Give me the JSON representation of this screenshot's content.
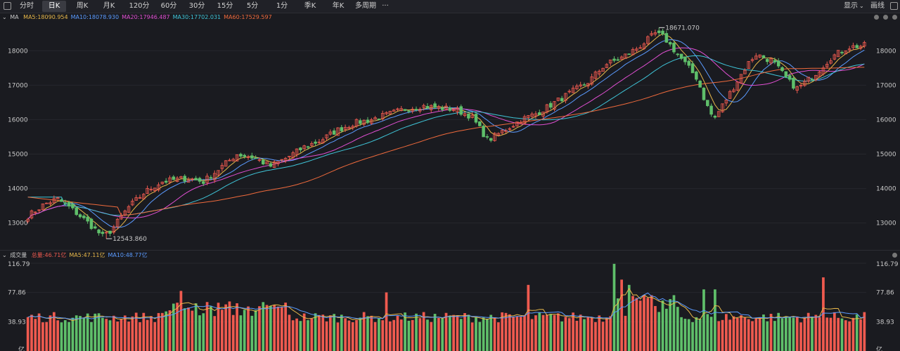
{
  "toolbar": {
    "tabs": [
      "分时",
      "日K",
      "周K",
      "月K",
      "120分",
      "60分",
      "30分",
      "15分",
      "5分",
      "1分",
      "季K",
      "年K",
      "多周期",
      "···"
    ],
    "active_tab": "日K",
    "display_label": "显示",
    "draw_label": "画线"
  },
  "ma_legend": {
    "title": "MA",
    "items": [
      {
        "label": "MA5:18090.954",
        "color": "#e8b84a"
      },
      {
        "label": "MA10:18078.930",
        "color": "#5b9bff"
      },
      {
        "label": "MA20:17946.487",
        "color": "#e14fd3"
      },
      {
        "label": "MA30:17702.031",
        "color": "#3fc5d8"
      },
      {
        "label": "MA60:17529.597",
        "color": "#ef6a3c"
      }
    ]
  },
  "vol_legend": {
    "title": "成交量",
    "items": [
      {
        "label": "总量:46.71亿",
        "color": "#ef5a4f"
      },
      {
        "label": "MA5:47.11亿",
        "color": "#e8b84a"
      },
      {
        "label": "MA10:48.77亿",
        "color": "#5b9bff"
      }
    ]
  },
  "colors": {
    "up": "#ef5a4f",
    "down": "#5fbf6a",
    "bg": "#1a1b20",
    "grid": "#26272d"
  },
  "chart_data": [
    {
      "type": "candlestick",
      "y_ticks": [
        "18000",
        "17000",
        "16000",
        "15000",
        "14000",
        "13000"
      ],
      "y_tick_values": [
        18000,
        17000,
        16000,
        15000,
        14000,
        13000
      ],
      "ylim": [
        12300,
        18800
      ],
      "annotations": [
        {
          "text": "18671.070",
          "value": 18671.07,
          "position_fraction": 0.755
        },
        {
          "text": "12543.860",
          "value": 12543.86,
          "position_fraction": 0.093
        }
      ],
      "anchors": [
        [
          0,
          13200
        ],
        [
          0.02,
          13550
        ],
        [
          0.035,
          13700
        ],
        [
          0.05,
          13450
        ],
        [
          0.07,
          13050
        ],
        [
          0.09,
          12600
        ],
        [
          0.1,
          12800
        ],
        [
          0.12,
          13450
        ],
        [
          0.14,
          13900
        ],
        [
          0.16,
          14200
        ],
        [
          0.19,
          14300
        ],
        [
          0.21,
          14200
        ],
        [
          0.23,
          14600
        ],
        [
          0.25,
          15000
        ],
        [
          0.27,
          14900
        ],
        [
          0.29,
          14650
        ],
        [
          0.31,
          14900
        ],
        [
          0.33,
          15200
        ],
        [
          0.35,
          15400
        ],
        [
          0.37,
          15700
        ],
        [
          0.39,
          15900
        ],
        [
          0.41,
          16000
        ],
        [
          0.43,
          16150
        ],
        [
          0.45,
          16300
        ],
        [
          0.47,
          16400
        ],
        [
          0.49,
          16350
        ],
        [
          0.51,
          16300
        ],
        [
          0.53,
          16100
        ],
        [
          0.55,
          15400
        ],
        [
          0.57,
          15700
        ],
        [
          0.59,
          16000
        ],
        [
          0.61,
          16200
        ],
        [
          0.63,
          16500
        ],
        [
          0.65,
          16800
        ],
        [
          0.67,
          17100
        ],
        [
          0.69,
          17600
        ],
        [
          0.71,
          17800
        ],
        [
          0.73,
          18100
        ],
        [
          0.75,
          18500
        ],
        [
          0.76,
          18400
        ],
        [
          0.78,
          17800
        ],
        [
          0.8,
          17200
        ],
        [
          0.81,
          16500
        ],
        [
          0.82,
          16000
        ],
        [
          0.84,
          16800
        ],
        [
          0.86,
          17600
        ],
        [
          0.87,
          17900
        ],
        [
          0.89,
          17700
        ],
        [
          0.91,
          17100
        ],
        [
          0.92,
          16900
        ],
        [
          0.94,
          17300
        ],
        [
          0.96,
          17800
        ],
        [
          0.98,
          18100
        ],
        [
          1.0,
          18150
        ]
      ],
      "ma_series": [
        {
          "name": "MA5",
          "color": "#e8b84a",
          "window": 5
        },
        {
          "name": "MA10",
          "color": "#5b9bff",
          "window": 10
        },
        {
          "name": "MA20",
          "color": "#e14fd3",
          "window": 20
        },
        {
          "name": "MA30",
          "color": "#3fc5d8",
          "window": 30
        },
        {
          "name": "MA60",
          "color": "#ef6a3c",
          "window": 60
        }
      ]
    },
    {
      "type": "bar",
      "y_ticks": [
        "116.79",
        "77.86",
        "38.93",
        "亿"
      ],
      "y_tick_values": [
        116.79,
        77.86,
        38.93,
        0
      ],
      "ylim": [
        0,
        116.79
      ],
      "unit": "亿",
      "spikes": [
        {
          "position_fraction": 0.185,
          "value": 80
        },
        {
          "position_fraction": 0.6,
          "value": 88
        },
        {
          "position_fraction": 0.7,
          "value": 116
        },
        {
          "position_fraction": 0.71,
          "value": 95
        },
        {
          "position_fraction": 0.72,
          "value": 88
        },
        {
          "position_fraction": 0.81,
          "value": 82
        },
        {
          "position_fraction": 0.82,
          "value": 82
        },
        {
          "position_fraction": 0.95,
          "value": 98
        },
        {
          "position_fraction": 0.427,
          "value": 78
        }
      ]
    }
  ]
}
